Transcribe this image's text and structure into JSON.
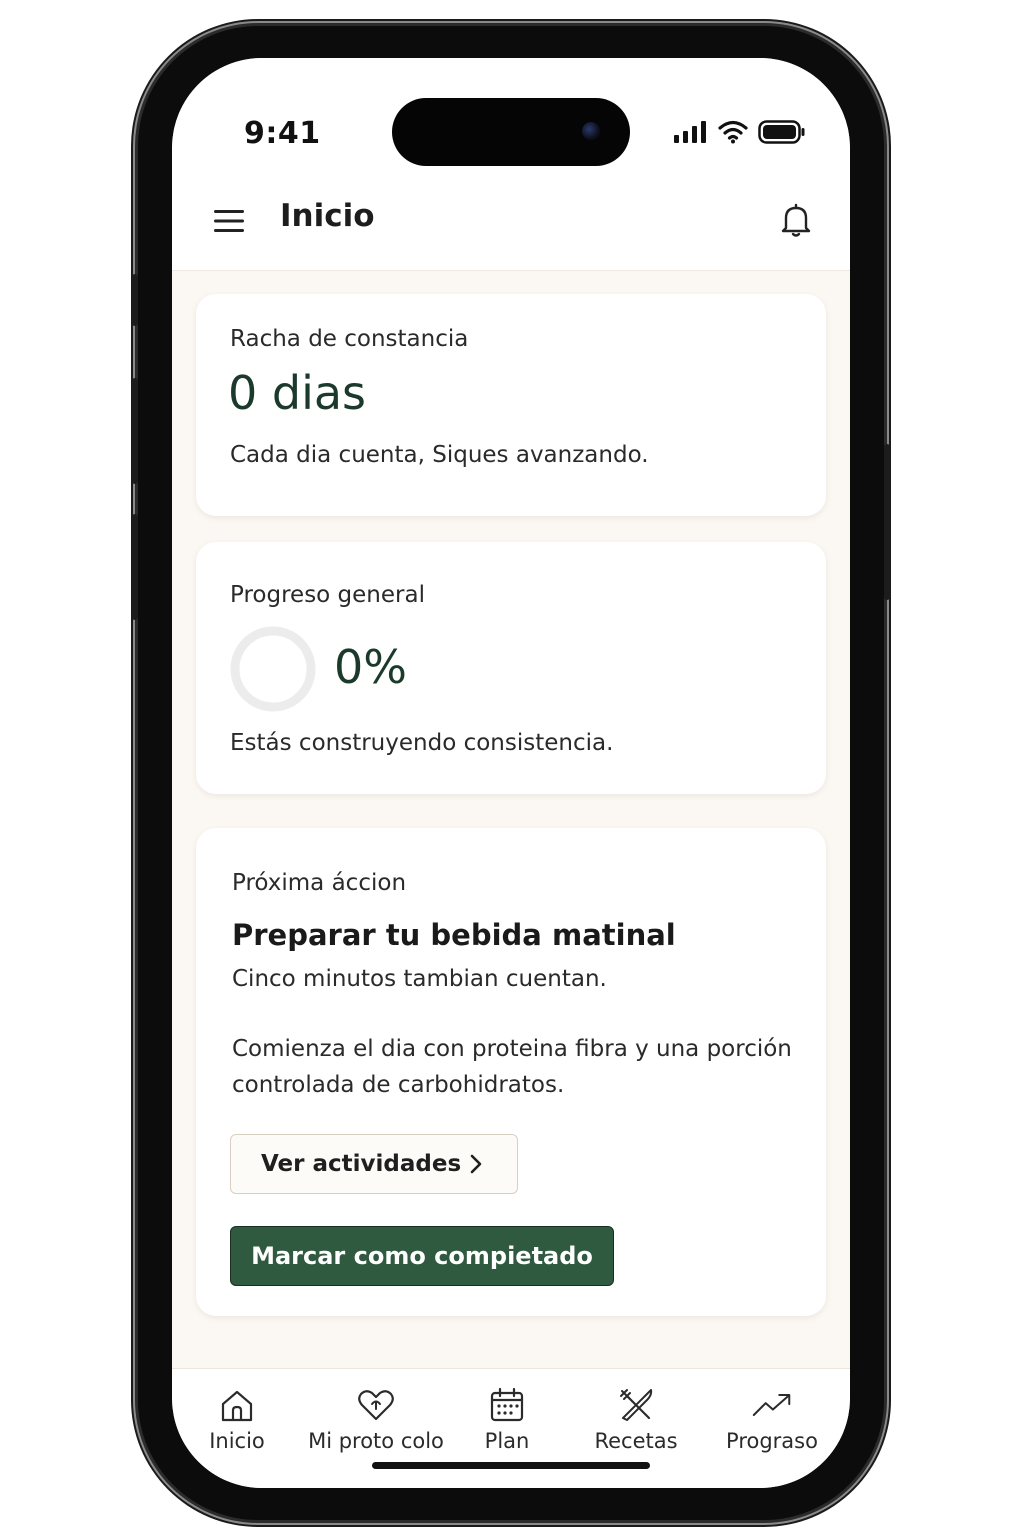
{
  "status_bar": {
    "time": "9:41",
    "signal_icon": "signal-icon",
    "wifi_icon": "wifi-icon",
    "battery_icon": "battery-icon"
  },
  "header": {
    "title": "Inicio",
    "menu_icon": "hamburger-menu-icon",
    "notification_icon": "bell-icon"
  },
  "streak_card": {
    "label": "Racha de constancia",
    "value": "0 dias",
    "message": "Cada dia cuenta, Siques avanzando."
  },
  "progress_card": {
    "label": "Progreso general",
    "percent_text": "0%",
    "progress_fraction": 0,
    "message": "Estás construyendo consistencia."
  },
  "next_action_card": {
    "label": "Próxima áccion",
    "title": "Preparar tu bebida matinal",
    "subtitle": "Cinco minutos tambian cuentan.",
    "description_line1": "Comienza el dia con proteina fibra y una porción",
    "description_line2": "controlada de carbohidratos.",
    "secondary_button": "Ver actividades",
    "primary_button": "Marcar como compietado"
  },
  "bottom_nav": {
    "items": [
      {
        "label": "Inicio",
        "icon": "home-icon"
      },
      {
        "label": "Mi proto colo",
        "icon": "heart-icon"
      },
      {
        "label": "Plan",
        "icon": "calendar-icon"
      },
      {
        "label": "Recetas",
        "icon": "utensils-icon"
      },
      {
        "label": "Prograso",
        "icon": "trending-up-icon"
      }
    ]
  },
  "colors": {
    "accent_green": "#2f5a3f",
    "value_green": "#1c3a2c",
    "background": "#fbf7f2",
    "card": "#ffffff"
  }
}
